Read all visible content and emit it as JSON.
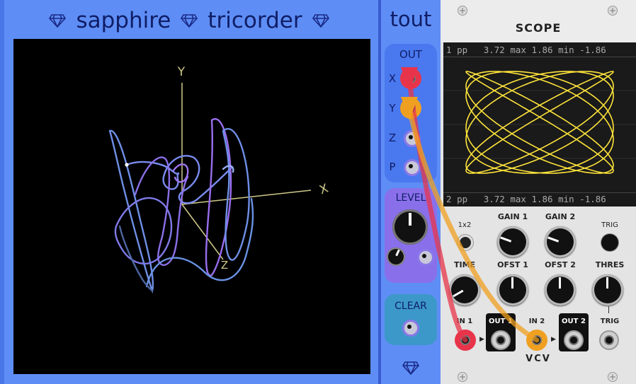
{
  "tricorder": {
    "title_left": "sapphire",
    "title_right": "tricorder",
    "axes": {
      "y": "Y",
      "x": "X",
      "z": "Z"
    }
  },
  "tout": {
    "title": "tout",
    "out_label": "OUT",
    "ports": [
      "X",
      "Y",
      "Z",
      "P"
    ],
    "level_label": "LEVEL",
    "clear_label": "CLEAR"
  },
  "scope": {
    "title": "SCOPE",
    "stat1": {
      "channel": "1",
      "label": "pp",
      "pp": "3.72",
      "max_label": "max",
      "max": "1.86",
      "min_label": "min",
      "min": "-1.86"
    },
    "stat2": {
      "channel": "2",
      "label": "pp",
      "pp": "3.72",
      "max_label": "max",
      "max": "1.86",
      "min_label": "min",
      "min": "-1.86"
    },
    "labels": {
      "mode": "1x2",
      "gain1": "GAIN 1",
      "gain2": "GAIN 2",
      "trig_btn": "TRIG",
      "time": "TIME",
      "ofst1": "OFST 1",
      "ofst2": "OFST 2",
      "thres": "THRES",
      "in1": "IN 1",
      "out1": "OUT 1",
      "in2": "IN 2",
      "out2": "OUT 2",
      "trig_in": "TRIG",
      "brand": "VCV"
    }
  },
  "colors": {
    "panel_blue": "#5e8ef5",
    "trace_yellow": "#ffe43a",
    "cable_red": "#e8344a",
    "cable_orange": "#f0a020"
  }
}
